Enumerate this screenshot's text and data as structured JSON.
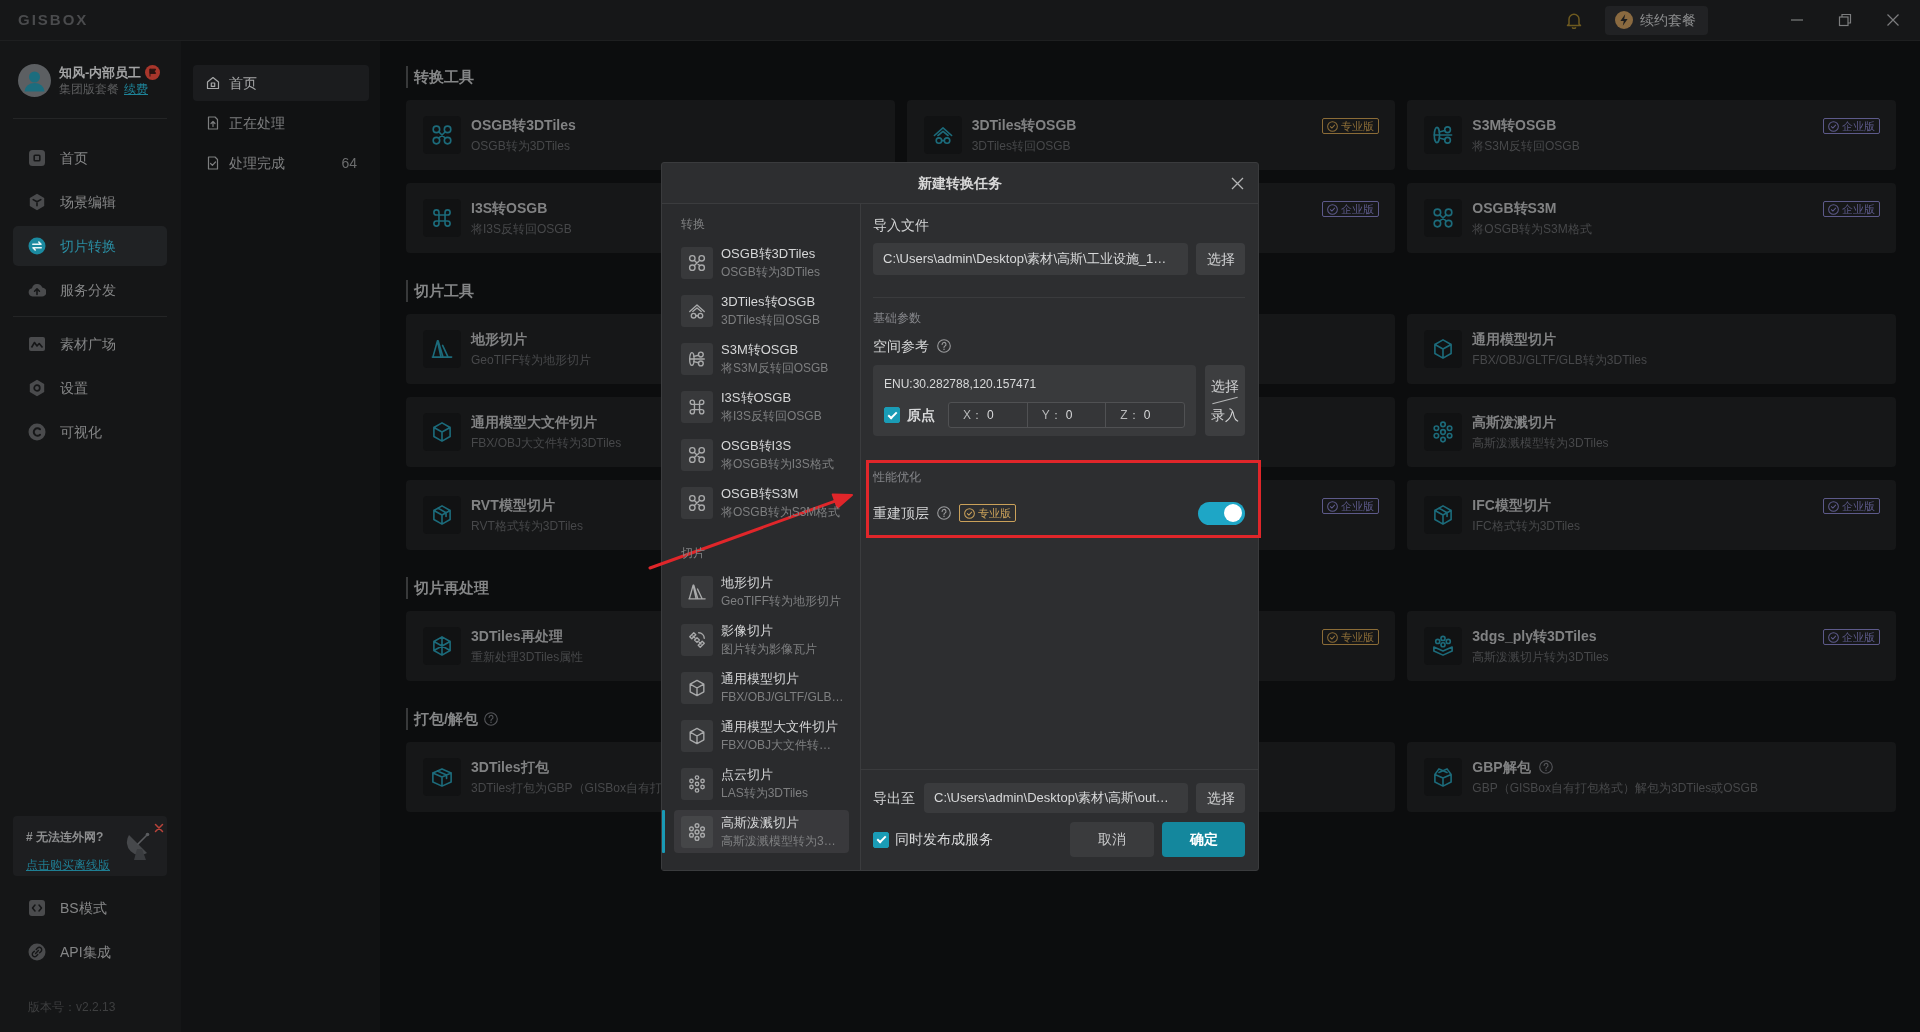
{
  "title_bar": {
    "logo": "GISBOX",
    "renew_button": "续约套餐"
  },
  "user": {
    "name": "知风-内部员工",
    "plan": "集团版套餐",
    "renew_link": "续费"
  },
  "nav_groups": [
    {
      "items": [
        {
          "label": "首页",
          "selected": false
        },
        {
          "label": "场景编辑",
          "selected": false
        },
        {
          "label": "切片转换",
          "selected": true
        },
        {
          "label": "服务分发",
          "selected": false
        }
      ]
    },
    {
      "items": [
        {
          "label": "素材广场",
          "selected": false
        },
        {
          "label": "设置",
          "selected": false
        },
        {
          "label": "可视化",
          "selected": false
        }
      ]
    }
  ],
  "promo": {
    "title": "# 无法连外网?",
    "link": "点击购买离线版"
  },
  "bottom_nav": [
    {
      "label": "BS模式",
      "selected": false
    },
    {
      "label": "API集成",
      "selected": false
    }
  ],
  "version": "版本号：v2.2.13",
  "subnav": [
    {
      "label": "首页",
      "selected": true
    },
    {
      "label": "正在处理",
      "selected": false
    },
    {
      "label": "处理完成",
      "selected": false,
      "count": "64"
    }
  ],
  "sections": [
    {
      "title": "转换工具",
      "cards": [
        {
          "kind": "tool",
          "title": "OSGB转3DTiles",
          "subtitle": "OSGB转为3DTiles"
        },
        {
          "kind": "tool",
          "title": "3DTiles转OSGB",
          "subtitle": "3DTiles转回OSGB",
          "badge": {
            "kind": "pro",
            "text": "专业版"
          }
        },
        {
          "kind": "tool",
          "title": "S3M转OSGB",
          "subtitle": "将S3M反转回OSGB",
          "badge": {
            "kind": "enterprise",
            "text": "企业版"
          }
        },
        {
          "kind": "tool",
          "title": "I3S转OSGB",
          "subtitle": "将I3S反转回OSGB"
        },
        {
          "kind": "covered",
          "badge": {
            "kind": "enterprise",
            "text": "企业版"
          }
        },
        {
          "kind": "tool",
          "title": "OSGB转S3M",
          "subtitle": "将OSGB转为S3M格式",
          "badge": {
            "kind": "enterprise",
            "text": "企业版"
          }
        }
      ]
    },
    {
      "title": "切片工具",
      "cards": [
        {
          "kind": "tool",
          "title": "地形切片",
          "subtitle": "GeoTIFF转为地形切片"
        },
        {
          "kind": "covered"
        },
        {
          "kind": "tool",
          "title": "通用模型切片",
          "subtitle": "FBX/OBJ/GLTF/GLB转为3DTiles"
        },
        {
          "kind": "tool",
          "title": "通用模型大文件切片",
          "subtitle": "FBX/OBJ大文件转为3DTiles"
        },
        {
          "kind": "covered"
        },
        {
          "kind": "tool",
          "title": "高斯泼溅切片",
          "subtitle": "高斯泼溅模型转为3DTiles"
        },
        {
          "kind": "tool",
          "title": "RVT模型切片",
          "subtitle": "RVT格式转为3DTiles"
        },
        {
          "kind": "covered",
          "badge": {
            "kind": "enterprise",
            "text": "企业版"
          }
        },
        {
          "kind": "tool",
          "title": "IFC模型切片",
          "subtitle": "IFC格式转为3DTiles",
          "badge": {
            "kind": "enterprise",
            "text": "企业版"
          }
        }
      ]
    },
    {
      "title": "切片再处理",
      "cards": [
        {
          "kind": "tool",
          "title": "3DTiles再处理",
          "subtitle": "重新处理3DTiles属性"
        },
        {
          "kind": "covered",
          "badge": {
            "kind": "pro",
            "text": "专业版"
          }
        },
        {
          "kind": "tool",
          "title": "3dgs_ply转3DTiles",
          "subtitle": "高斯泼溅切片转为3DTiles",
          "badge": {
            "kind": "enterprise",
            "text": "企业版"
          }
        }
      ]
    },
    {
      "title": "打包/解包",
      "help": true,
      "cards": [
        {
          "kind": "tool",
          "title": "3DTiles打包",
          "subtitle": "3DTiles打包为GBP（GISBox自有打"
        },
        {
          "kind": "covered"
        },
        {
          "kind": "tool",
          "title": "GBP解包",
          "help": true,
          "subtitle": "GBP（GISBox自有打包格式）解包为3DTiles或OSGB"
        }
      ]
    }
  ],
  "dialog": {
    "title": "新建转换任务",
    "task_groups": [
      {
        "label": "转换",
        "items": [
          {
            "title": "OSGB转3DTiles",
            "subtitle": "OSGB转为3DTiles",
            "selected": false
          },
          {
            "title": "3DTiles转OSGB",
            "subtitle": "3DTiles转回OSGB",
            "selected": false
          },
          {
            "title": "S3M转OSGB",
            "subtitle": "将S3M反转回OSGB",
            "selected": false
          },
          {
            "title": "I3S转OSGB",
            "subtitle": "将I3S反转回OSGB",
            "selected": false
          },
          {
            "title": "OSGB转I3S",
            "subtitle": "将OSGB转为I3S格式",
            "selected": false
          },
          {
            "title": "OSGB转S3M",
            "subtitle": "将OSGB转为S3M格式",
            "selected": false
          }
        ]
      },
      {
        "label": "切片",
        "items": [
          {
            "title": "地形切片",
            "subtitle": "GeoTIFF转为地形切片",
            "selected": false
          },
          {
            "title": "影像切片",
            "subtitle": "图片转为影像瓦片",
            "selected": false
          },
          {
            "title": "通用模型切片",
            "subtitle": "FBX/OBJ/GLTF/GLB…",
            "selected": false
          },
          {
            "title": "通用模型大文件切片",
            "subtitle": "FBX/OBJ大文件转…",
            "selected": false
          },
          {
            "title": "点云切片",
            "subtitle": "LAS转为3DTiles",
            "selected": false
          },
          {
            "title": "高斯泼溅切片",
            "subtitle": "高斯泼溅模型转为3…",
            "selected": true
          }
        ]
      }
    ],
    "import_file": {
      "label": "导入文件",
      "value": "C:\\Users\\admin\\Desktop\\素材\\高斯\\工业设施_1…",
      "button": "选择"
    },
    "basic_params": {
      "heading": "基础参数",
      "label": "空间参考",
      "help": true,
      "value": "ENU:30.282788,120.157471",
      "origin": {
        "label": "原点",
        "checked": true
      },
      "coords": [
        {
          "label": "X：",
          "value": "0"
        },
        {
          "label": "Y：",
          "value": "0"
        },
        {
          "label": "Z：",
          "value": "0"
        }
      ],
      "button": {
        "top": "选择",
        "bottom": "录入"
      }
    },
    "performance": {
      "heading": "性能优化",
      "label": "重建顶层",
      "help": true,
      "badge": {
        "kind": "pro",
        "text": "专业版"
      },
      "on": true
    },
    "export_to": {
      "label": "导出至",
      "value": "C:\\Users\\admin\\Desktop\\素材\\高斯\\out…",
      "button": "选择"
    },
    "publish": {
      "label": "同时发布成服务",
      "checked": true
    },
    "buttons": [
      {
        "label": "取消",
        "kind": "secondary"
      },
      {
        "label": "确定",
        "kind": "primary"
      }
    ]
  }
}
